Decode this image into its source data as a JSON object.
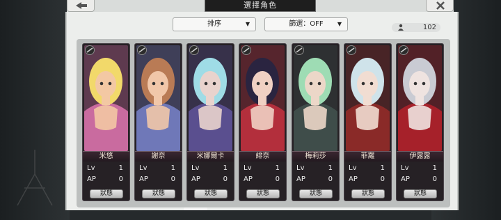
{
  "header": {
    "title": "選擇角色"
  },
  "controls": {
    "sort_label": "排序",
    "filter_label": "篩選：OFF",
    "count": "102"
  },
  "characters": [
    {
      "name": "米悠",
      "lv_label": "Lv",
      "lv": "1",
      "ap_label": "AP",
      "ap": "0",
      "button": "狀態",
      "palette": [
        "#f3c8a3",
        "#f2d96a",
        "#c96b9f"
      ]
    },
    {
      "name": "謝奈",
      "lv_label": "Lv",
      "lv": "1",
      "ap_label": "AP",
      "ap": "0",
      "button": "狀態",
      "palette": [
        "#f1c7a9",
        "#b97b55",
        "#6f78b8"
      ]
    },
    {
      "name": "米娜爾卡",
      "lv_label": "Lv",
      "lv": "1",
      "ap_label": "AP",
      "ap": "0",
      "button": "狀態",
      "palette": [
        "#e9d3cd",
        "#9fdce6",
        "#5a4f8f"
      ]
    },
    {
      "name": "緋奈",
      "lv_label": "Lv",
      "lv": "1",
      "ap_label": "AP",
      "ap": "0",
      "button": "狀態",
      "palette": [
        "#f0d0c3",
        "#2a2440",
        "#b32f3c"
      ]
    },
    {
      "name": "梅莉莎",
      "lv_label": "Lv",
      "lv": "1",
      "ap_label": "AP",
      "ap": "0",
      "button": "狀態",
      "palette": [
        "#ecd7c8",
        "#9edcb4",
        "#3f4d4a"
      ]
    },
    {
      "name": "菲羅",
      "lv_label": "Lv",
      "lv": "1",
      "ap_label": "AP",
      "ap": "0",
      "button": "狀態",
      "palette": [
        "#f1ddd2",
        "#cfe3ea",
        "#8a2a28"
      ]
    },
    {
      "name": "伊露露",
      "lv_label": "Lv",
      "lv": "1",
      "ap_label": "AP",
      "ap": "0",
      "button": "狀態",
      "palette": [
        "#efe3e0",
        "#c9cbd3",
        "#a6212a"
      ]
    }
  ],
  "icons": {
    "back": "back-arrow-icon",
    "close": "close-icon",
    "dropdown": "triangle-down-icon",
    "count": "user-icon",
    "lock": "lock-icon"
  }
}
